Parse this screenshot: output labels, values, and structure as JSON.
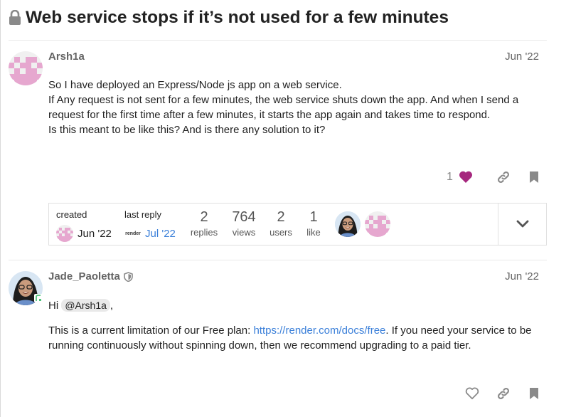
{
  "topic": {
    "title": "Web service stops if it’s not used for a few minutes",
    "lock_icon": "lock-icon"
  },
  "post1": {
    "username": "Arsh1a",
    "date": "Jun '22",
    "paragraphs": [
      "So I have deployed an Express/Node js app on a web service.",
      "If Any request is not sent for a few minutes, the web service shuts down the app. And when I send a request for the first time after a few minutes, it starts the app again and takes time to respond.",
      "Is this meant to be like this? And is there any solution to it?"
    ],
    "like_count": "1",
    "colors": {
      "heart": "#a6277e",
      "avatar": "#e6a7cf"
    }
  },
  "topic_map": {
    "created_label": "created",
    "created_date": "Jun '22",
    "last_reply_label": "last reply",
    "last_reply_avatar_text": "render",
    "last_reply_date": "Jul '22",
    "stats": [
      {
        "num": "2",
        "label": "replies"
      },
      {
        "num": "764",
        "label": "views"
      },
      {
        "num": "2",
        "label": "users"
      },
      {
        "num": "1",
        "label": "like"
      }
    ]
  },
  "post2": {
    "username": "Jade_Paoletta",
    "date": "Jun '22",
    "greeting": "Hi",
    "mention": "@Arsh1a",
    "greeting_end": ",",
    "line_before_link": "This is a current limitation of our Free plan: ",
    "link_text": "https://render.com/docs/free",
    "line_after_link": ". If you need your service to be running continuously without spinning down, then we recommend upgrading to a paid tier."
  }
}
